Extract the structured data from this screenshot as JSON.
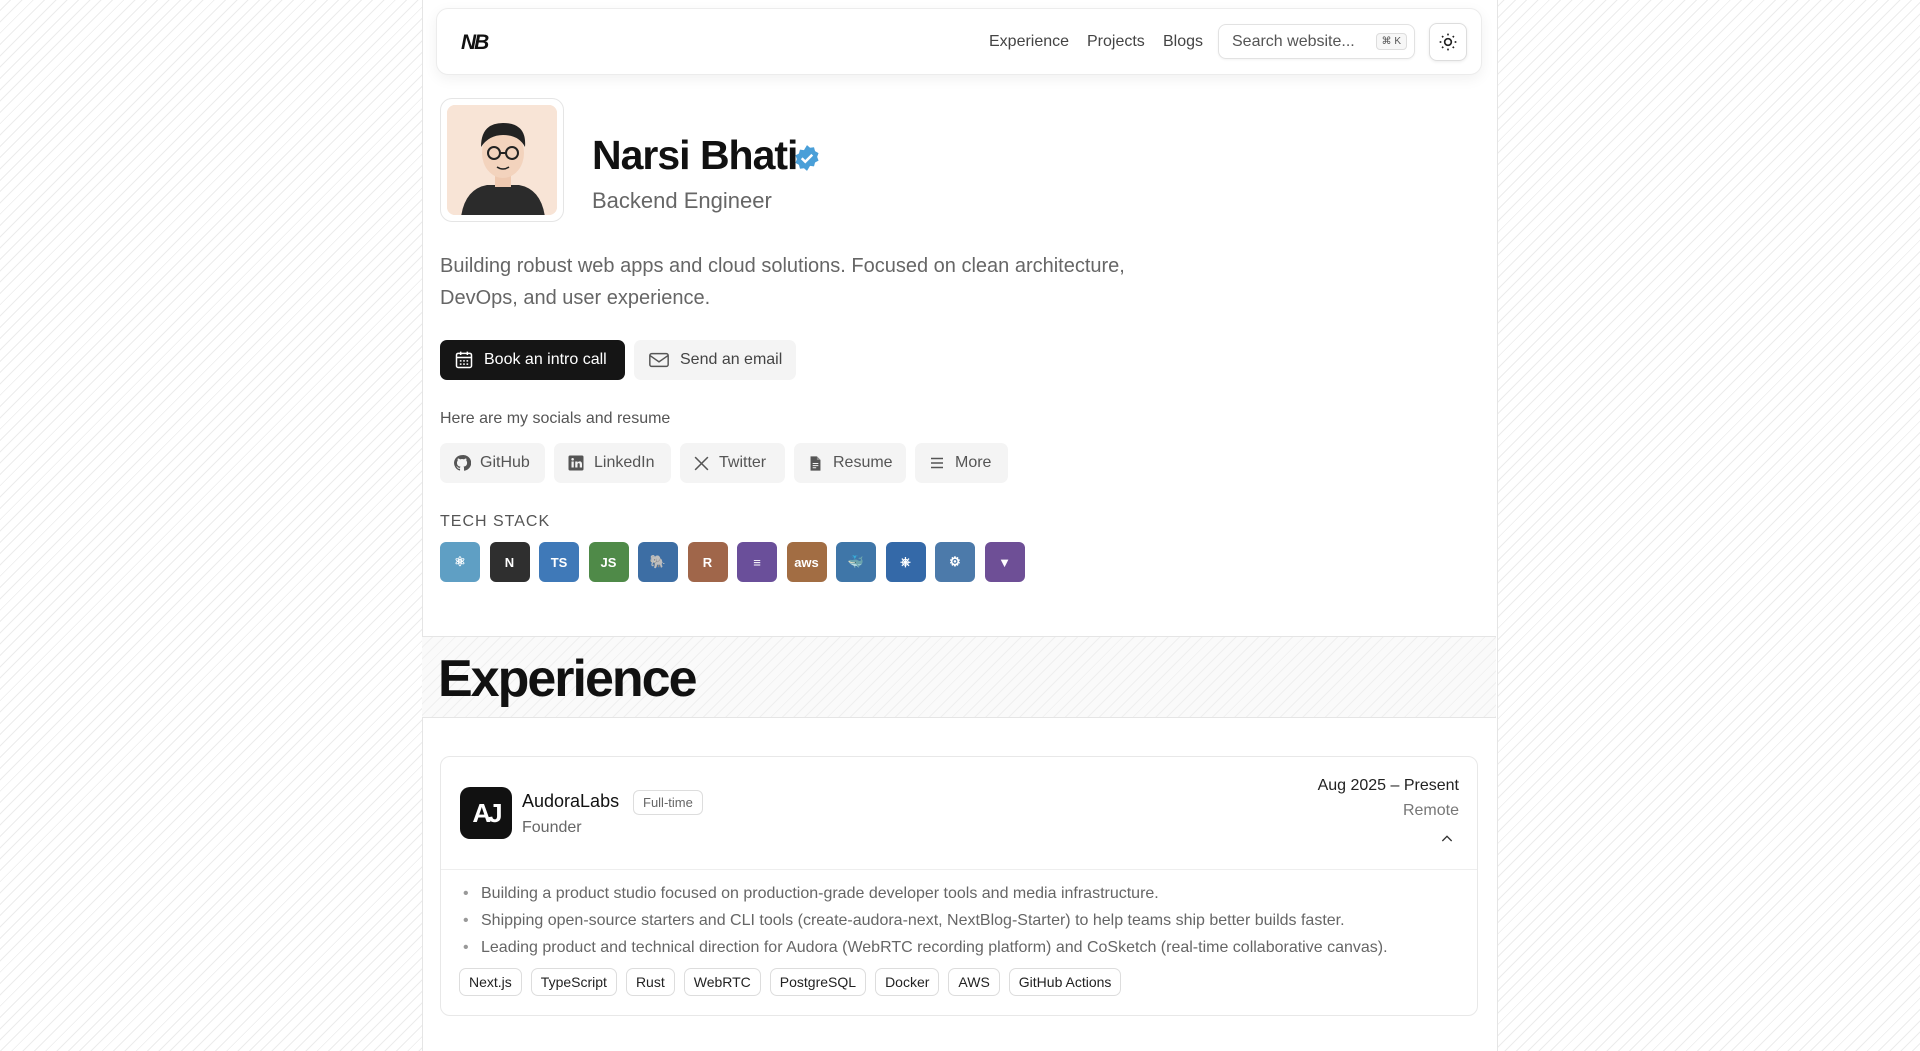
{
  "nav": {
    "logo": "NB",
    "links": [
      "Experience",
      "Projects",
      "Blogs"
    ],
    "search_placeholder": "Search website...",
    "search_shortcut": "⌘ K",
    "theme_icon": "sun-icon"
  },
  "profile": {
    "name": "Narsi Bhati",
    "role": "Backend Engineer",
    "bio": "Building robust web apps and cloud solutions. Focused on clean architecture, DevOps, and user experience.",
    "primary_cta": "Book an intro call",
    "secondary_cta": "Send an email",
    "verified_color": "#4a9fd8"
  },
  "socials": {
    "title": "Here are my socials and resume",
    "items": [
      {
        "label": "GitHub",
        "icon": "github-icon"
      },
      {
        "label": "LinkedIn",
        "icon": "linkedin-icon"
      },
      {
        "label": "Twitter",
        "icon": "x-icon"
      },
      {
        "label": "Resume",
        "icon": "file-icon"
      },
      {
        "label": "More",
        "icon": "menu-icon"
      }
    ]
  },
  "tech_stack": {
    "title": "TECH STACK",
    "items": [
      {
        "name": "react-icon",
        "color": "#5f9fc4",
        "glyph": "⚛"
      },
      {
        "name": "nextjs-icon",
        "color": "#2f2f2f",
        "glyph": "N"
      },
      {
        "name": "typescript-icon",
        "color": "#3f79b8",
        "glyph": "TS"
      },
      {
        "name": "nodejs-icon",
        "color": "#4f8a48",
        "glyph": "JS"
      },
      {
        "name": "postgresql-icon",
        "color": "#3d6ea4",
        "glyph": "🐘"
      },
      {
        "name": "rust-icon",
        "color": "#a0664a",
        "glyph": "R"
      },
      {
        "name": "prisma-icon",
        "color": "#6a4f9a",
        "glyph": "≡"
      },
      {
        "name": "aws-icon",
        "color": "#a26d43",
        "glyph": "aws"
      },
      {
        "name": "docker-icon",
        "color": "#3f76a8",
        "glyph": "🐳"
      },
      {
        "name": "kubernetes-icon",
        "color": "#3469a8",
        "glyph": "⎈"
      },
      {
        "name": "github-actions-icon",
        "color": "#4c7aaa",
        "glyph": "⚙"
      },
      {
        "name": "terraform-icon",
        "color": "#6e4f96",
        "glyph": "▼"
      }
    ]
  },
  "experience": {
    "heading": "Experience",
    "jobs": [
      {
        "logo": "AJ",
        "company": "AudoraLabs",
        "employment_type": "Full-time",
        "position": "Founder",
        "dates": "Aug 2025 – Present",
        "location": "Remote",
        "bullets": [
          "Building a product studio focused on production-grade developer tools and media infrastructure.",
          "Shipping open-source starters and CLI tools (create-audora-next, NextBlog-Starter) to help teams ship better builds faster.",
          "Leading product and technical direction for Audora (WebRTC recording platform) and CoSketch (real-time collaborative canvas)."
        ],
        "tags": [
          "Next.js",
          "TypeScript",
          "Rust",
          "WebRTC",
          "PostgreSQL",
          "Docker",
          "AWS",
          "GitHub Actions"
        ]
      }
    ]
  }
}
